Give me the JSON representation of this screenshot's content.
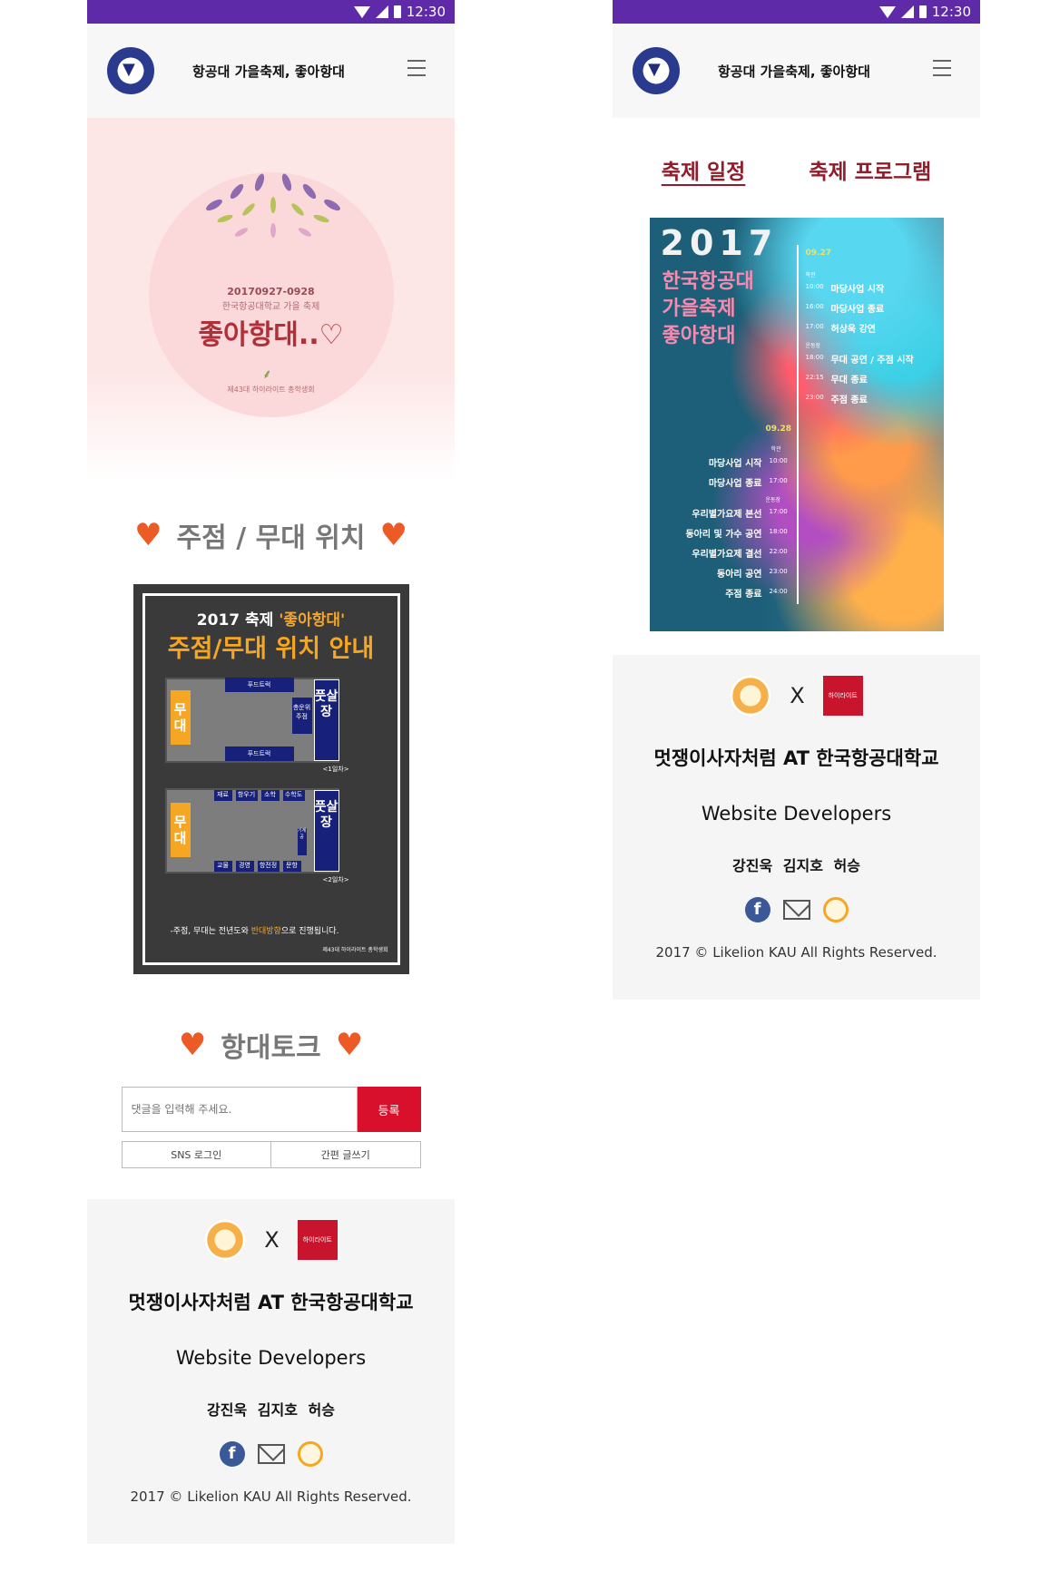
{
  "status": {
    "time": "12:30"
  },
  "app": {
    "title": "항공대 가을축제, 좋아항대"
  },
  "hero": {
    "date": "20170927-0928",
    "subtitle": "한국항공대학교 가을 축제",
    "main": "좋아항대..♡",
    "org": "제43대 하이라이트 총학생회"
  },
  "map_section": {
    "title": "주점 / 무대 위치",
    "poster_line1_prefix": "2017 축제 ",
    "poster_line1_highlight": "'좋아항대'",
    "poster_line2": "주점/무대 위치 안내",
    "stage_label": "무대",
    "futsal_label": "풋살장",
    "foodtruck": "푸드트럭",
    "committee": "총운위 주점",
    "day1": "<1일차>",
    "day2": "<2일차>",
    "booths_top": [
      "재료",
      "항우기",
      "소학",
      "수학도"
    ],
    "booths_bottom": [
      "교물",
      "경영",
      "항전정",
      "문항"
    ],
    "booth_side": "기계공",
    "note_prefix": "-주점, 무대는 전년도와 ",
    "note_highlight": "반대방향",
    "note_suffix": "으로 진행됩니다.",
    "org": "제43대 하이라이트 총학생회"
  },
  "talk": {
    "title": "항대토크",
    "placeholder": "댓글을 입력해 주세요.",
    "submit": "등록",
    "sns_login": "SNS 로그인",
    "quick_write": "간편 글쓰기"
  },
  "footer": {
    "x": "X",
    "hi_logo_text": "하이라이트",
    "school": "멋쟁이사자처럼 AT 한국항공대학교",
    "developers": "Website Developers",
    "names": "강진욱 김지호 허승",
    "copyright": "2017 © Likelion KAU All Rights Reserved."
  },
  "right": {
    "tabs": [
      "축제 일정",
      "축제 프로그램"
    ],
    "poster": {
      "year": "2017",
      "title_lines": [
        "한국항공대",
        "가을축제",
        "좋아항대"
      ],
      "day1": "09.27",
      "day2": "09.28",
      "place_hakgwan": "학관",
      "place_stadium": "운동장",
      "day1_events": [
        {
          "time": "10:00",
          "event": "마당사업 시작"
        },
        {
          "time": "16:00",
          "event": "마당사업 종료"
        },
        {
          "time": "17:00",
          "event": "허상욱 강연"
        },
        {
          "time": "18:00",
          "event": "무대 공연 / 주점 시작"
        },
        {
          "time": "22:15",
          "event": "무대 종료"
        },
        {
          "time": "23:00",
          "event": "주점 종료"
        }
      ],
      "day2_events": [
        {
          "time": "10:00",
          "event": "마당사업 시작"
        },
        {
          "time": "17:00",
          "event": "마당사업 종료"
        },
        {
          "time": "17:00",
          "event": "우리별가요제 본선"
        },
        {
          "time": "18:00",
          "event": "동아리 및 가수 공연"
        },
        {
          "time": "22:00",
          "event": "우리별가요제 결선"
        },
        {
          "time": "23:00",
          "event": "동아리 공연"
        },
        {
          "time": "24:00",
          "event": "주점 종료"
        }
      ]
    }
  }
}
